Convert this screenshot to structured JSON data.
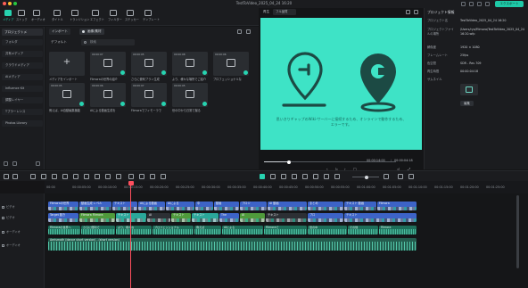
{
  "window": {
    "title": "TestToVideo_2025_04_24 16:20",
    "export_label": "エクスポート",
    "traffic_colors": [
      "#ff5f57",
      "#febc2e",
      "#28c840"
    ]
  },
  "toolbar": {
    "items": [
      {
        "label": "メディア",
        "icon": "media-icon",
        "active": true
      },
      {
        "label": "ストック",
        "icon": "stock-icon",
        "active": false
      },
      {
        "label": "オーディオ",
        "icon": "audio-icon",
        "active": false
      },
      {
        "label": "タイトル",
        "icon": "title-icon",
        "active": false
      },
      {
        "label": "トランジション",
        "icon": "transition-icon",
        "active": false
      },
      {
        "label": "エフェクト",
        "icon": "effect-icon",
        "active": false
      },
      {
        "label": "フィルター",
        "icon": "filter-icon",
        "active": false
      },
      {
        "label": "ステッカー",
        "icon": "sticker-icon",
        "active": false
      },
      {
        "label": "テンプレート",
        "icon": "template-icon",
        "active": false
      }
    ]
  },
  "sidebar": {
    "header": "プロジェクトメ",
    "items": [
      "フォルダ",
      "共有メディア",
      "クラウドメディア",
      "AIメディア",
      "Influence Kit",
      "調整レイヤー",
      "Tブラーレンス",
      "Photos Library"
    ]
  },
  "media": {
    "tab_import": "インポート",
    "tab_default": "画像/素材",
    "default_label": "デフォルト",
    "search_placeholder": "検索",
    "items": [
      {
        "caption": "メディアをインポート",
        "type": "import"
      },
      {
        "caption": "Filmoraの世界の紹介",
        "type": "audio",
        "duration": "00:00:07"
      },
      {
        "caption": "さらに便利プラン生成",
        "type": "audio",
        "duration": "00:00:05"
      },
      {
        "caption": "より、様々な場所でご紹介",
        "type": "audio",
        "duration": "00:00:08"
      },
      {
        "caption": "プロフェッショナルな",
        "type": "audio",
        "duration": "00:00:06"
      },
      {
        "caption": "例えば、AI自動編集機能",
        "type": "audio",
        "duration": "00:00:05"
      },
      {
        "caption": "AIによる動画生成を",
        "type": "audio",
        "duration": "00:00:06"
      },
      {
        "caption": "Filmoraでフィモーラで",
        "type": "audio",
        "duration": "00:00:07"
      },
      {
        "caption": "世の中から日常で撮る",
        "type": "audio",
        "duration": "00:00:05"
      }
    ]
  },
  "preview": {
    "label": "再生",
    "quality": "フル品質",
    "caption": "思いきりギャップのWiki-サーバーに接続するため、オンラインで動作するため、",
    "caption2": "エラーです。",
    "time_current": "00:00:14:00",
    "time_total": "00:00:04:18",
    "bg_color": "#3ee3c6"
  },
  "properties": {
    "title": "プロジェクト情報",
    "rows": [
      {
        "key": "プロジェクト名",
        "value": "TestToVideo_2025_04_24 16:20"
      },
      {
        "key": "プロジェクトファイルの場所",
        "value": "/Users/ryo/Filmora/TestToVideo_2025_04_24 16:20.wfp"
      },
      {
        "key": "解像度",
        "value": "1920 × 1080"
      },
      {
        "key": "フレームレート",
        "value": "25fps"
      },
      {
        "key": "色空間",
        "value": "SDR - Rec.709"
      },
      {
        "key": "再生時間",
        "value": "00:00:04:18"
      },
      {
        "key": "サムネイル",
        "value": ""
      }
    ],
    "edit_button": "編集"
  },
  "timeline": {
    "ruler": [
      "00:00",
      "00:00:05:00",
      "00:00:10:00",
      "00:00:15:00",
      "00:00:20:00",
      "00:00:25:00",
      "00:00:30:00",
      "00:00:35:00",
      "00:00:40:00",
      "00:00:45:00",
      "00:00:50:00",
      "00:00:55:00",
      "00:01:00:00",
      "00:01:05:00",
      "00:01:10:00",
      "00:01:15:00",
      "00:01:20:00",
      "00:01:25:00",
      "00:01:30:00"
    ],
    "tracks": [
      "ビデオ",
      "ビデオ",
      "オーディオ",
      "オーディオ"
    ],
    "video_clips_top": [
      "Filmoraの世界",
      "動画生成 レベル",
      "テキスト",
      "AIによる動画",
      "AIによる",
      "中",
      "動画",
      "プロジ",
      "AI 動画",
      "まとめ",
      "テキスト 動画",
      "Filmora"
    ],
    "video_clips_mid": [
      "Target 動き",
      "Filmora Filmora",
      "テキスト",
      "AI",
      "テキスト",
      "テキスト",
      "The",
      "AI",
      "テキスト",
      "プロ",
      "テキスト"
    ],
    "audio_clips": [
      "Filmoraの世界へ",
      "さらに便利で",
      "より、様々な",
      "プロフェッショナル",
      "例えば",
      "AIによる",
      "Filmoraで",
      "世の中",
      "その他",
      "Filmora"
    ],
    "music_label": "Aerismoth (dance short version) - (short version)"
  }
}
